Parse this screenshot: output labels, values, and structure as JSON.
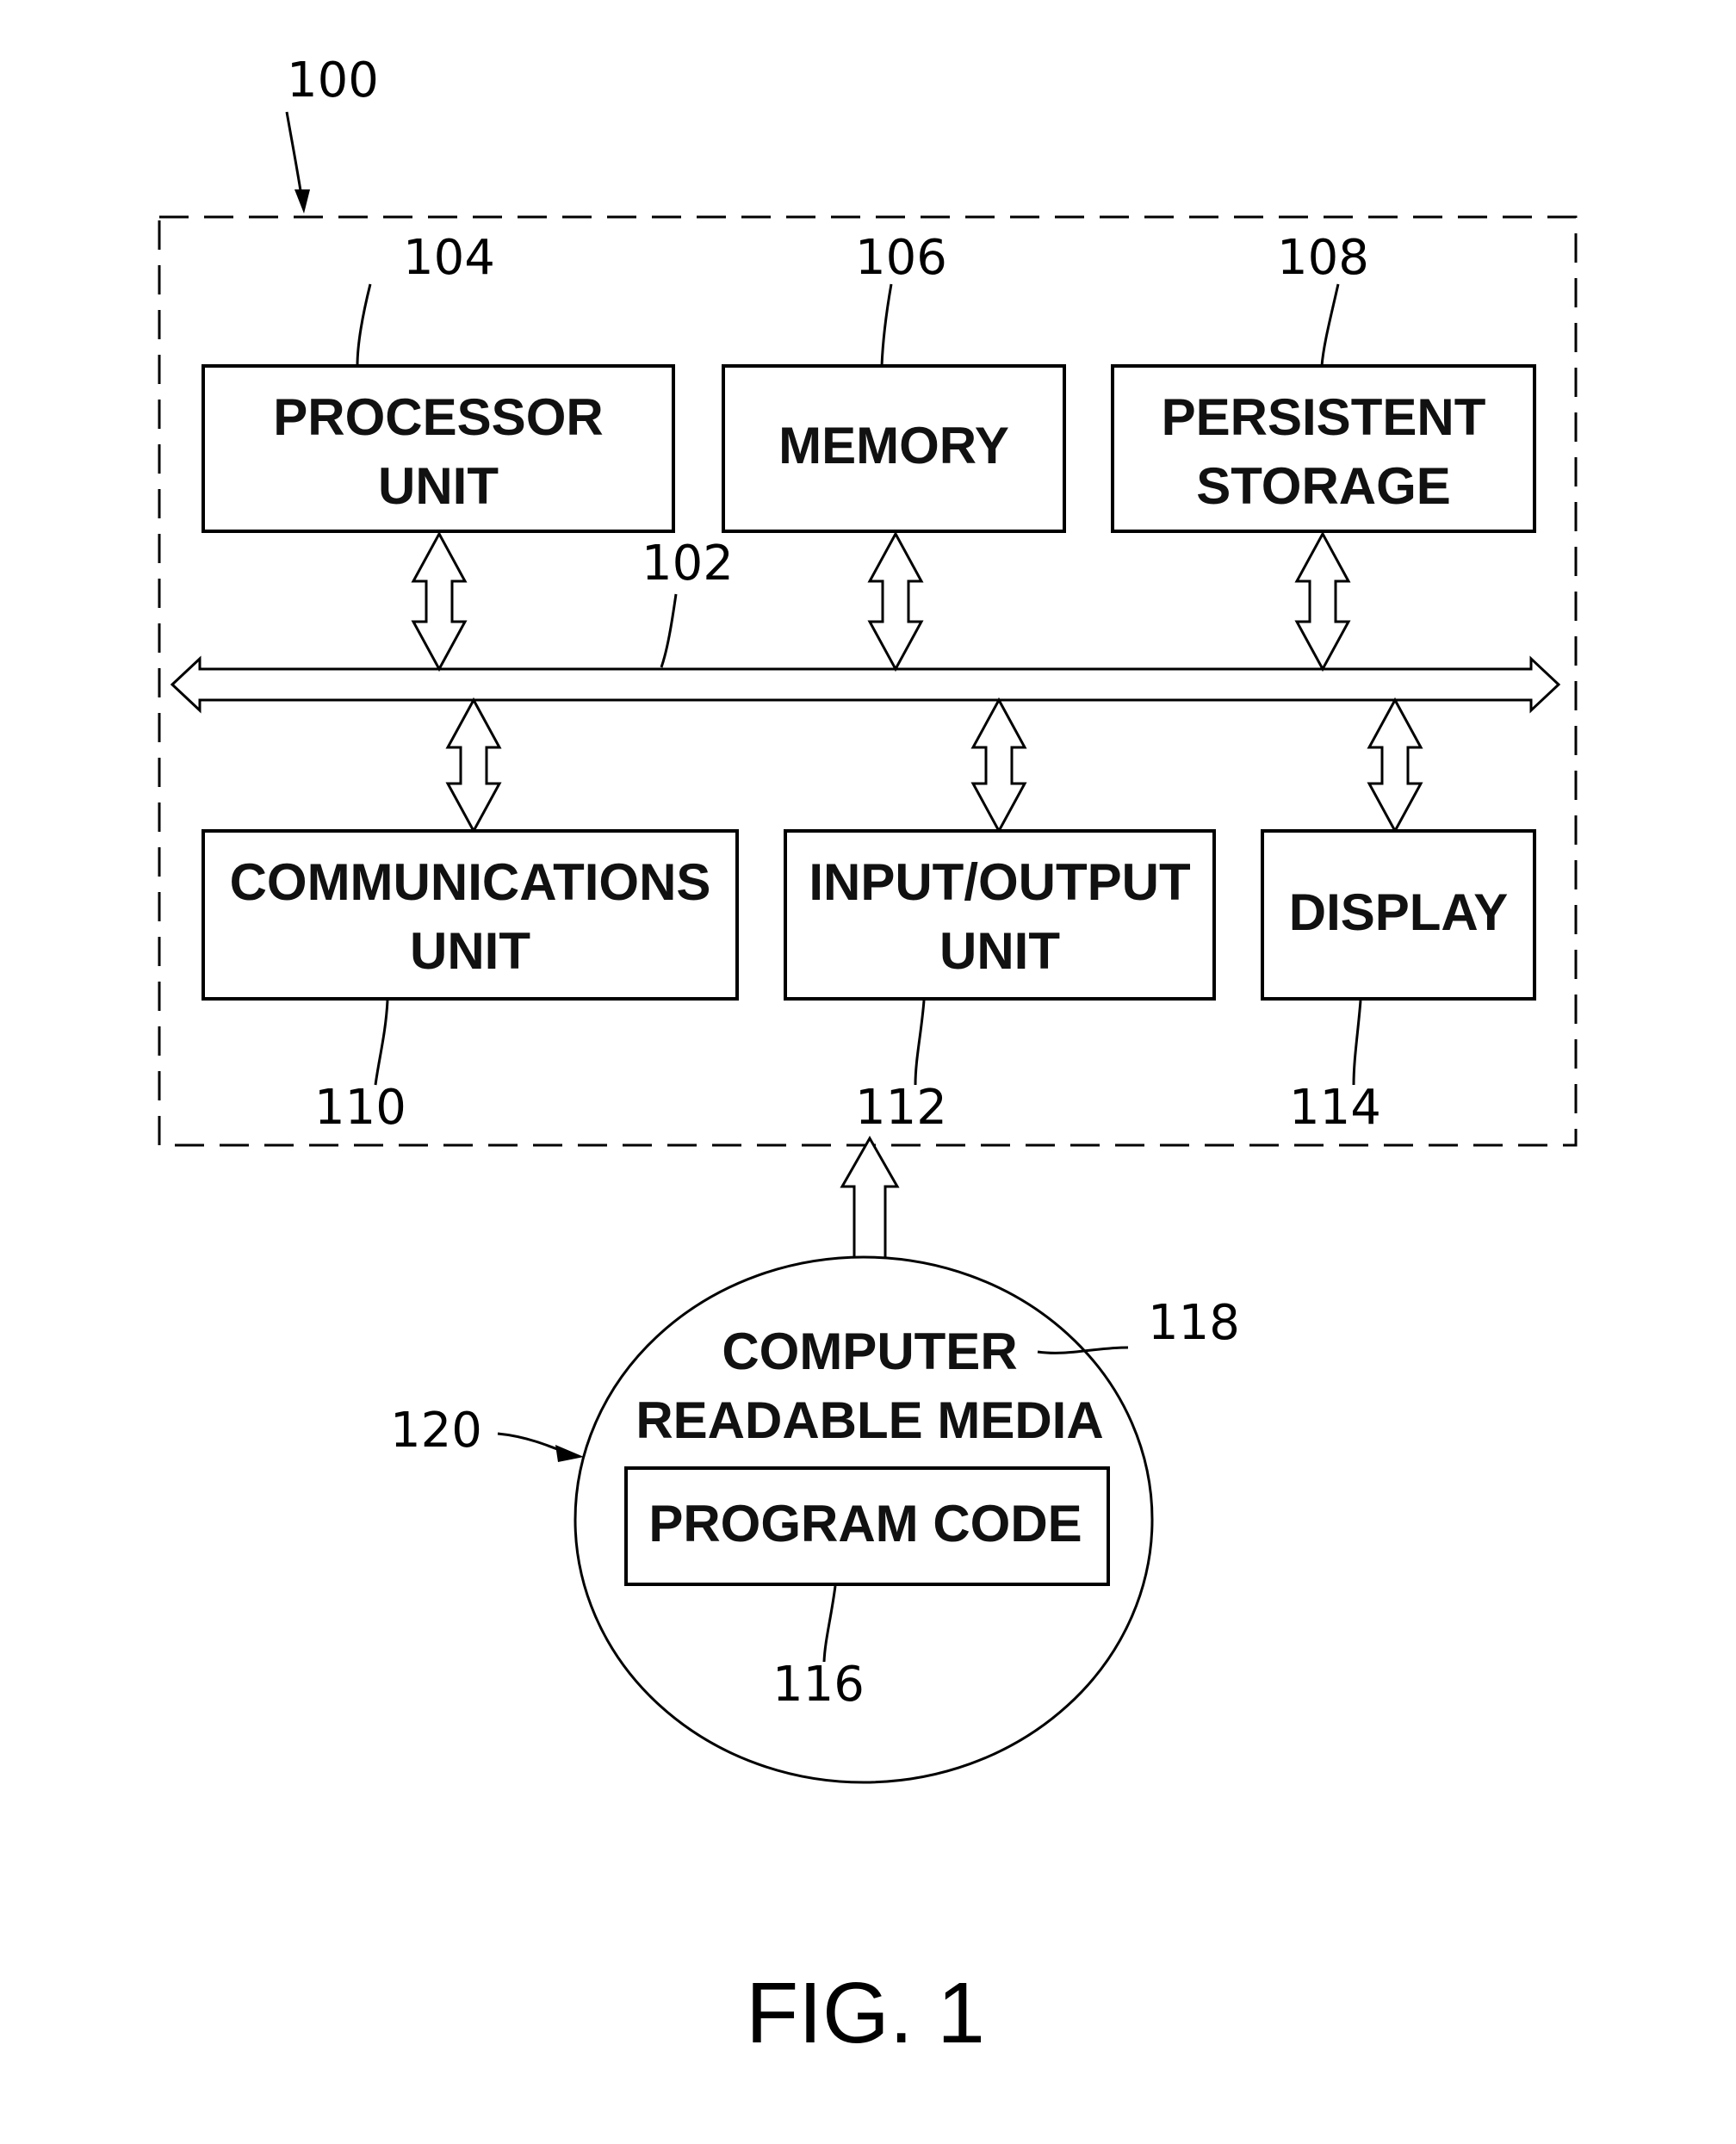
{
  "figure": {
    "caption": "FIG. 1",
    "system": {
      "ref": "100"
    },
    "bus": {
      "ref": "102"
    },
    "components": {
      "processor": {
        "ref": "104",
        "lines": [
          "PROCESSOR",
          "UNIT"
        ]
      },
      "memory": {
        "ref": "106",
        "lines": [
          "MEMORY"
        ]
      },
      "storage": {
        "ref": "108",
        "lines": [
          "PERSISTENT",
          "STORAGE"
        ]
      },
      "comms": {
        "ref": "110",
        "lines": [
          "COMMUNICATIONS",
          "UNIT"
        ]
      },
      "io": {
        "ref": "112",
        "lines": [
          "INPUT/OUTPUT",
          "UNIT"
        ]
      },
      "display": {
        "ref": "114",
        "lines": [
          "DISPLAY"
        ]
      }
    },
    "media": {
      "ref_media": "118",
      "ref_product": "120",
      "lines": [
        "COMPUTER",
        "READABLE MEDIA"
      ],
      "program_code": {
        "ref": "116",
        "label": "PROGRAM CODE"
      }
    }
  }
}
